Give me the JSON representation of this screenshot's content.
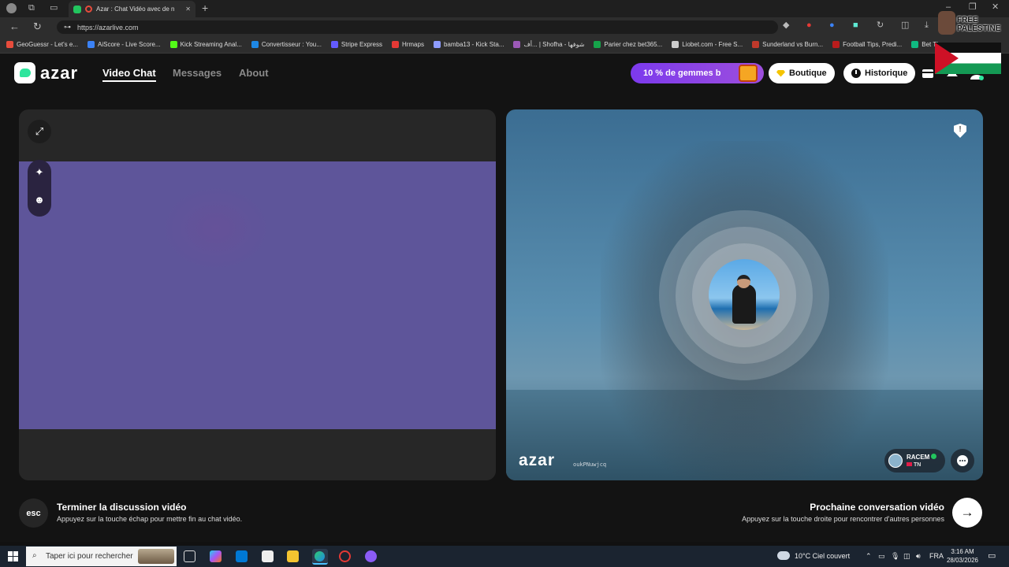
{
  "browser": {
    "tab_title": "Azar : Chat Vidéo avec de n",
    "url": "https://azarlive.com",
    "bookmarks": [
      {
        "label": "GeoGuessr - Let's e...",
        "color": "#e74c3c"
      },
      {
        "label": "AiScore - Live Score...",
        "color": "#3b82f6"
      },
      {
        "label": "Kick Streaming Anal...",
        "color": "#53fc18"
      },
      {
        "label": "Convertisseur : You...",
        "color": "#1e88e5"
      },
      {
        "label": "Stripe Express",
        "color": "#635bff"
      },
      {
        "label": "Hrmaps",
        "color": "#e53935"
      },
      {
        "label": "bamba13 - Kick Sta...",
        "color": "#8e9cff"
      },
      {
        "label": "أف... | Shofha - شوفها",
        "color": "#9b59b6"
      },
      {
        "label": "Parier chez bet365...",
        "color": "#16a34a"
      },
      {
        "label": "Liobet.com - Free S...",
        "color": "#cccccc"
      },
      {
        "label": "Sunderland vs Burn...",
        "color": "#c0392b"
      },
      {
        "label": "Football Tips, Predi...",
        "color": "#b91c1c"
      },
      {
        "label": "Bet Th",
        "color": "#10b981"
      }
    ]
  },
  "overlay": {
    "free_palestine": "FREE PALESTINE"
  },
  "app": {
    "logo_text": "azar",
    "nav": {
      "video_chat": "Video Chat",
      "messages": "Messages",
      "about": "About"
    },
    "promo_text": "10 % de gemmes b",
    "shop_label": "Boutique",
    "history_label": "Historique",
    "colors": {
      "accent": "#2ee59d",
      "promo": "#8b3fe0"
    }
  },
  "remote": {
    "watermark": "azar",
    "watermark_id": "oukPNuwjcq",
    "user_name": "RACEM",
    "country": "TN"
  },
  "footer": {
    "esc_key": "esc",
    "end_title": "Terminer la discussion vidéo",
    "end_sub": "Appuyez sur la touche échap pour mettre fin au chat vidéo.",
    "next_title": "Prochaine conversation vidéo",
    "next_sub": "Appuyez sur la touche droite pour rencontrer d'autres personnes"
  },
  "taskbar": {
    "search_placeholder": "Taper ici pour rechercher",
    "weather": "10°C  Ciel couvert",
    "language": "FRA",
    "time": "3:16 AM",
    "date": "28/03/2026"
  }
}
